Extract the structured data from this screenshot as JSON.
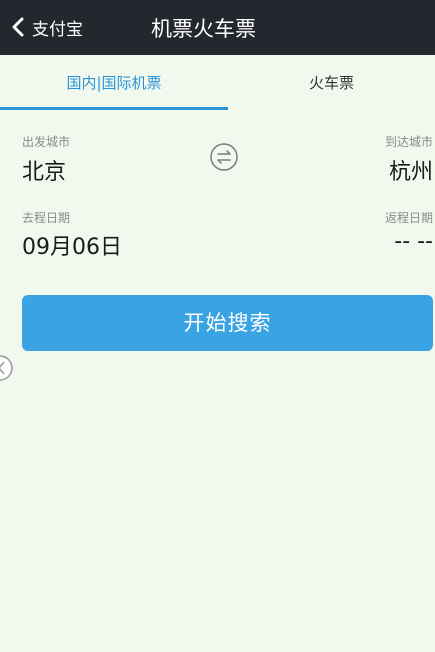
{
  "header": {
    "back_label": "支付宝",
    "title": "机票火车票"
  },
  "tabs": [
    {
      "label": "国内|国际机票",
      "active": true
    },
    {
      "label": "火车票",
      "active": false
    }
  ],
  "form": {
    "departure_label": "出发城市",
    "departure_value": "北京",
    "arrival_label": "到达城市",
    "arrival_value": "杭州",
    "depart_date_label": "去程日期",
    "depart_date_value": "09月06日",
    "return_date_label": "返程日期",
    "return_date_value": "-- --",
    "search_button": "开始搜索"
  },
  "colors": {
    "header_bg": "#24272e",
    "accent": "#2c94d4",
    "button_bg": "#3aa3e3",
    "page_bg": "#f1f9ef"
  },
  "icons": [
    "chevron-left-icon",
    "swap-icon",
    "edge-handle-icon"
  ]
}
